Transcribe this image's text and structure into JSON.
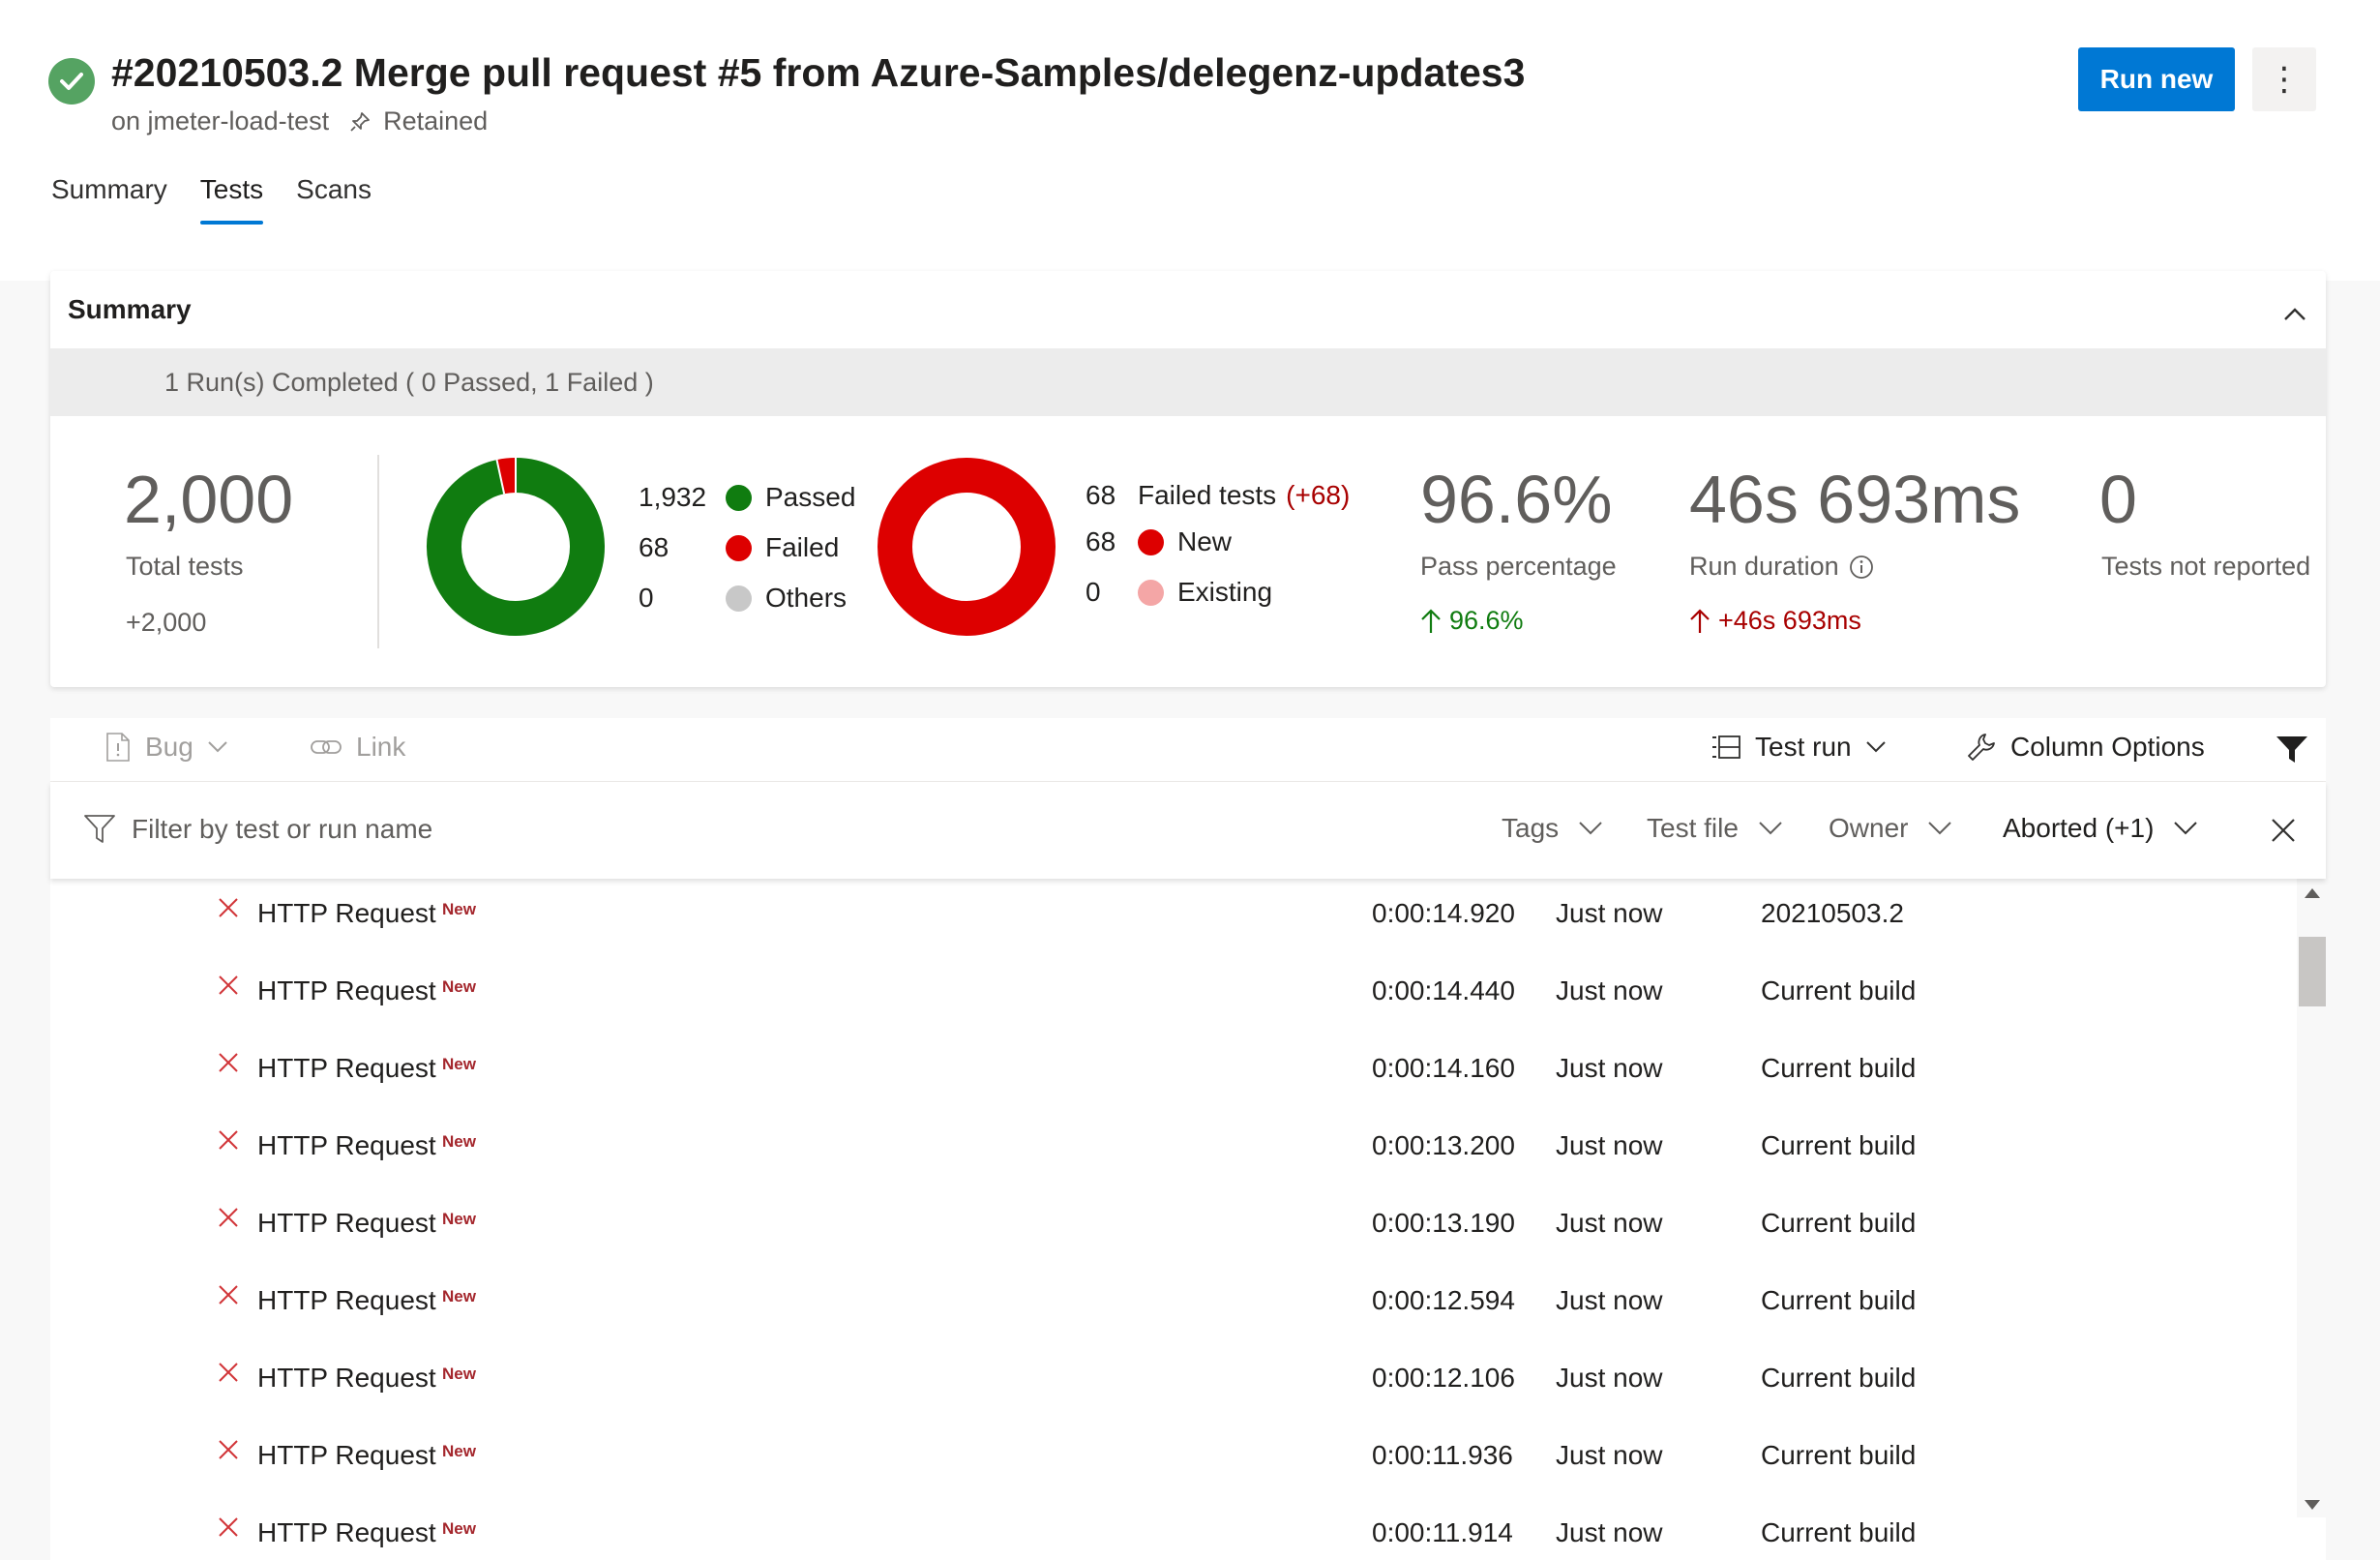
{
  "header": {
    "title": "#20210503.2 Merge pull request #5 from Azure-Samples/delegenz-updates3",
    "pipeline": "on jmeter-load-test",
    "retained": "Retained",
    "run_new": "Run new",
    "more": "⋮"
  },
  "tabs": [
    {
      "label": "Summary"
    },
    {
      "label": "Tests"
    },
    {
      "label": "Scans"
    }
  ],
  "summary": {
    "title": "Summary",
    "runs_status": "1 Run(s) Completed ( 0 Passed, 1 Failed )",
    "total_tests": "2,000",
    "total_tests_label": "Total tests",
    "total_tests_delta": "+2,000",
    "outcome_legend": [
      {
        "count": "1,932",
        "label": "Passed",
        "color": "#107c10"
      },
      {
        "count": "68",
        "label": "Failed",
        "color": "#dd0000"
      },
      {
        "count": "0",
        "label": "Others",
        "color": "#c8c8c8"
      }
    ],
    "failed_header_count": "68",
    "failed_header_label": "Failed tests",
    "failed_header_delta": "(+68)",
    "failed_legend": [
      {
        "count": "68",
        "label": "New",
        "color": "#dd0000"
      },
      {
        "count": "0",
        "label": "Existing",
        "color": "#f4a6a6"
      }
    ],
    "pass_percentage": "96.6%",
    "pass_percentage_label": "Pass percentage",
    "pass_percentage_delta": "96.6%",
    "run_duration": "46s 693ms",
    "run_duration_label": "Run duration",
    "run_duration_delta": "+46s 693ms",
    "not_reported": "0",
    "not_reported_label": "Tests not reported"
  },
  "chart_data": [
    {
      "type": "pie",
      "categories": [
        "Passed",
        "Failed",
        "Others"
      ],
      "values": [
        1932,
        68,
        0
      ]
    },
    {
      "type": "pie",
      "categories": [
        "New",
        "Existing"
      ],
      "values": [
        68,
        0
      ]
    }
  ],
  "toolbar": {
    "bug": "Bug",
    "link": "Link",
    "test_run": "Test run",
    "column_options": "Column Options"
  },
  "filters": {
    "placeholder": "Filter by test or run name",
    "tags": "Tags",
    "test_file": "Test file",
    "owner": "Owner",
    "aborted": "Aborted (+1)"
  },
  "rows": [
    {
      "name": "HTTP Request",
      "badge": "New",
      "duration": "0:00:14.920",
      "when": "Just now",
      "build": "20210503.2"
    },
    {
      "name": "HTTP Request",
      "badge": "New",
      "duration": "0:00:14.440",
      "when": "Just now",
      "build": "Current build"
    },
    {
      "name": "HTTP Request",
      "badge": "New",
      "duration": "0:00:14.160",
      "when": "Just now",
      "build": "Current build"
    },
    {
      "name": "HTTP Request",
      "badge": "New",
      "duration": "0:00:13.200",
      "when": "Just now",
      "build": "Current build"
    },
    {
      "name": "HTTP Request",
      "badge": "New",
      "duration": "0:00:13.190",
      "when": "Just now",
      "build": "Current build"
    },
    {
      "name": "HTTP Request",
      "badge": "New",
      "duration": "0:00:12.594",
      "when": "Just now",
      "build": "Current build"
    },
    {
      "name": "HTTP Request",
      "badge": "New",
      "duration": "0:00:12.106",
      "when": "Just now",
      "build": "Current build"
    },
    {
      "name": "HTTP Request",
      "badge": "New",
      "duration": "0:00:11.936",
      "when": "Just now",
      "build": "Current build"
    },
    {
      "name": "HTTP Request",
      "badge": "New",
      "duration": "0:00:11.914",
      "when": "Just now",
      "build": "Current build"
    }
  ],
  "colors": {
    "accent": "#0078d4",
    "success": "#55a362",
    "fail": "#a4262c",
    "delta_up_good": "#107c10",
    "delta_up_bad": "#a80000"
  }
}
